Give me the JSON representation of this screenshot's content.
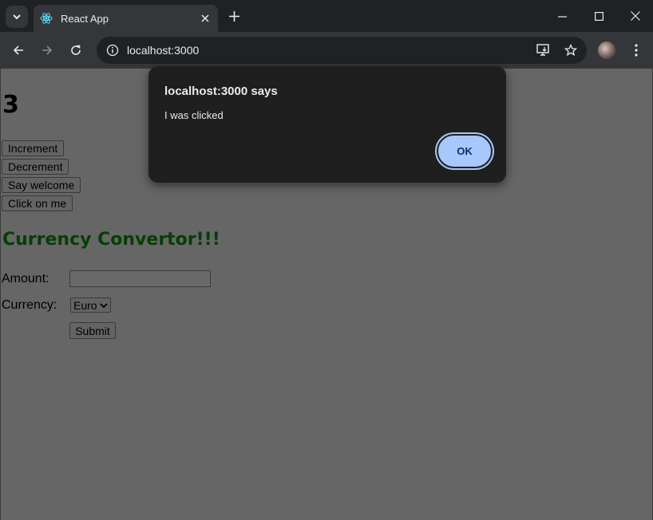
{
  "browser": {
    "tab_title": "React App",
    "url": "localhost:3000"
  },
  "page": {
    "counter": "3",
    "buttons": [
      {
        "label": "Increment"
      },
      {
        "label": "Decrement"
      },
      {
        "label": "Say welcome"
      },
      {
        "label": "Click on me"
      }
    ],
    "heading": "Currency Convertor!!!",
    "heading_color": "#083d06",
    "amount_label": "Amount:",
    "amount_value": "",
    "currency_label": "Currency:",
    "currency_selected": "Euro",
    "submit_label": "Submit"
  },
  "dialog": {
    "title": "localhost:3000 says",
    "message": "I was clicked",
    "ok_label": "OK",
    "accent": "#a8c7fa"
  },
  "icons": {
    "tab_search": "chevron-down-icon",
    "favicon": "react-icon",
    "tab_close": "close-icon",
    "new_tab": "plus-icon",
    "minimize": "minimize-icon",
    "maximize": "maximize-icon",
    "window_close": "close-icon",
    "back": "back-arrow-icon",
    "forward": "forward-arrow-icon",
    "reload": "reload-icon",
    "site_info": "info-icon",
    "install": "install-app-icon",
    "bookmark": "star-icon",
    "menu": "kebab-menu-icon"
  }
}
